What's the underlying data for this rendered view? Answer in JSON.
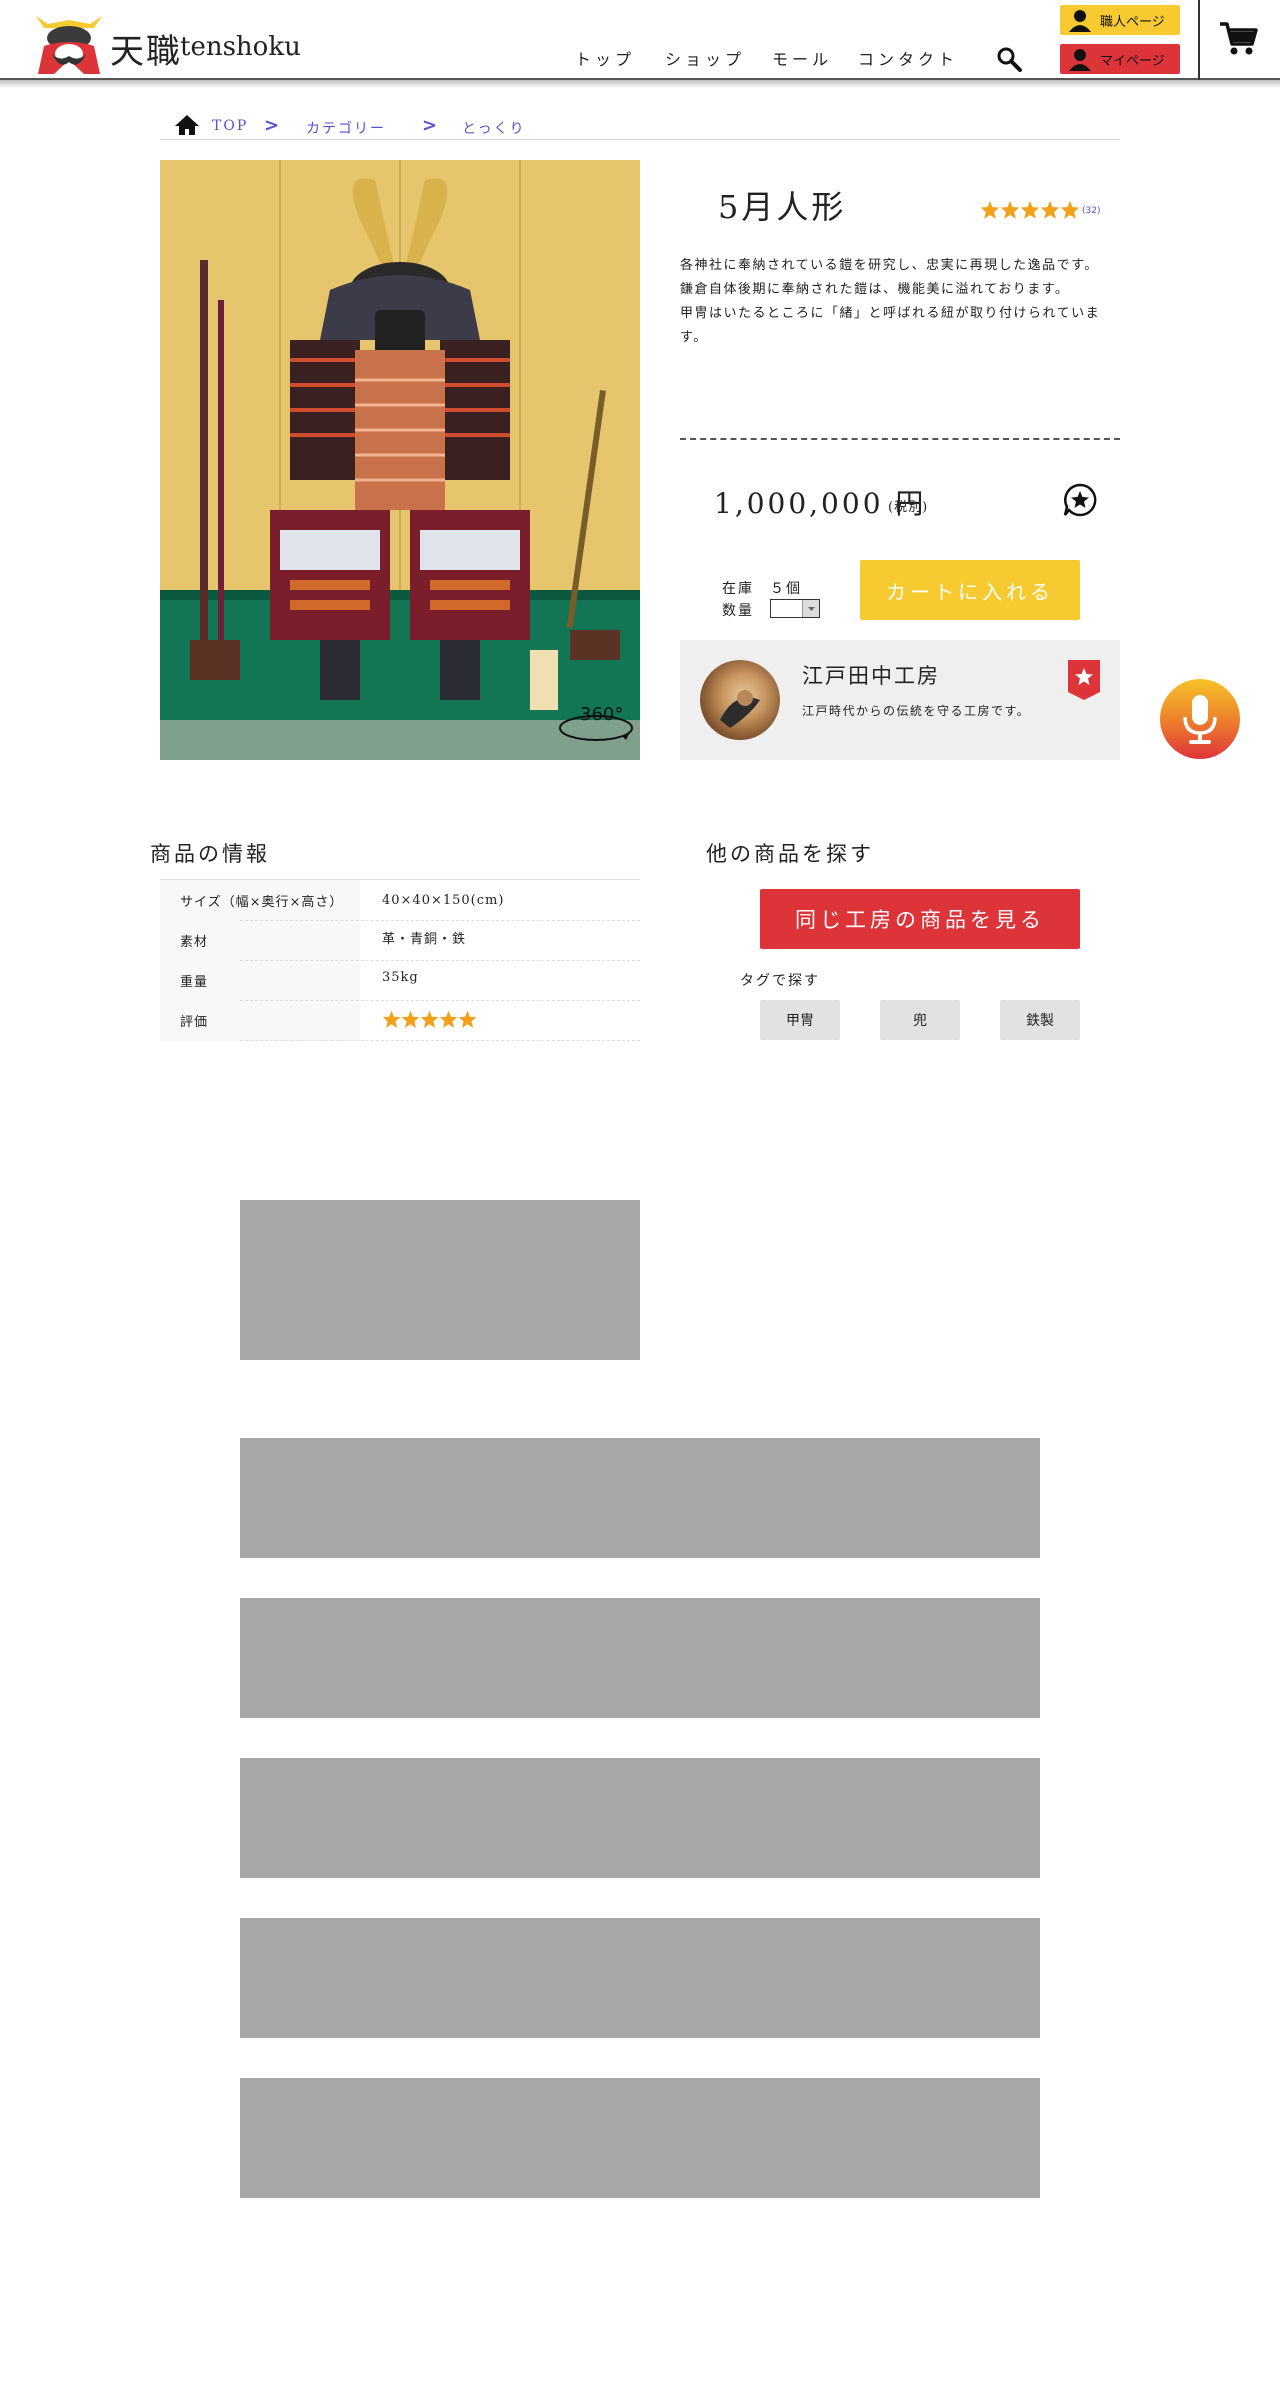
{
  "header": {
    "brand_jp": "天職",
    "brand_en": "tenshoku",
    "nav": [
      "トップ",
      "ショップ",
      "モール",
      "コンタクト"
    ],
    "artisan_button": "職人ページ",
    "mypage_button": "マイページ",
    "colors": {
      "artisan": "#f6ca30",
      "mypage": "#dc3439"
    }
  },
  "breadcrumb": {
    "items": [
      "TOP",
      "カテゴリー",
      "とっくり"
    ],
    "separator": ">"
  },
  "product": {
    "image_badge": "360°",
    "title": "5月人形",
    "rating": 5,
    "review_count": "(32)",
    "description": [
      "各神社に奉納されている鎧を研究し、忠実に再現した逸品です。",
      "鎌倉自体後期に奉納された鎧は、機能美に溢れております。",
      "甲冑はいたるところに「緒」と呼ばれる紐が取り付けられています。"
    ],
    "price": "1,000,000 円",
    "price_note": "(税別)",
    "stock_label": "在庫",
    "stock_value": "５個",
    "quantity_label": "数量",
    "cart_button": "カートに入れる"
  },
  "maker": {
    "name": "江戸田中工房",
    "description": "江戸時代からの伝統を守る工房です。"
  },
  "specs": {
    "heading": "商品の情報",
    "rows": [
      {
        "label": "サイズ（幅×奥行×高さ）",
        "value": "40×40×150(cm)"
      },
      {
        "label": "素材",
        "value": "革・青銅・鉄"
      },
      {
        "label": "重量",
        "value": "35kg"
      },
      {
        "label": "評価",
        "value": ""
      }
    ],
    "rating": 5
  },
  "explore": {
    "heading": "他の商品を探す",
    "same_workshop_button": "同じ工房の商品を見る",
    "tags_label": "タグで探す",
    "tags": [
      "甲冑",
      "兜",
      "鉄製"
    ]
  }
}
